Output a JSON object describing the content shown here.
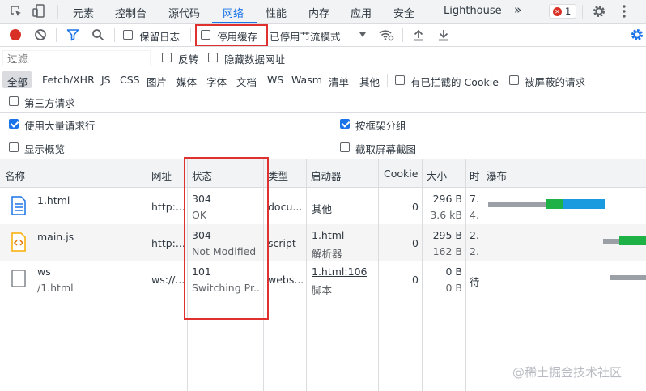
{
  "tabs": {
    "items": [
      "元素",
      "控制台",
      "源代码",
      "网络",
      "性能",
      "内存",
      "应用",
      "安全",
      "Lighthouse"
    ],
    "more": "»",
    "error_count": "1"
  },
  "toolbar": {
    "preserve_log": "保留日志",
    "disable_cache": "停用缓存",
    "throttle": "已停用节流模式"
  },
  "filter": {
    "placeholder": "过滤",
    "invert": "反转",
    "hide_data_urls": "隐藏数据网址"
  },
  "types": [
    "全部",
    "Fetch/XHR",
    "JS",
    "CSS",
    "图片",
    "媒体",
    "字体",
    "文档",
    "WS",
    "Wasm",
    "清单",
    "其他"
  ],
  "blocked_cookies": "有已拦截的 Cookie",
  "blocked_requests": "被屏蔽的请求",
  "third_party": "第三方请求",
  "settings": {
    "big_rows": "使用大量请求行",
    "group_by_frame": "按框架分组",
    "overview": "显示概览",
    "screenshots": "截取屏幕截图"
  },
  "table": {
    "headers": {
      "name": "名称",
      "url": "网址",
      "status": "状态",
      "type": "类型",
      "initiator": "启动器",
      "cookie": "Cookie",
      "size": "大小",
      "time": "时",
      "waterfall": "瀑布"
    },
    "rows": [
      {
        "name": "1.html",
        "path": "",
        "url": "http:...",
        "status_code": "304",
        "status_text": "OK",
        "type": "docu...",
        "initiator": "其他",
        "initiator_sub": "",
        "cookie": "0",
        "size_top": "296 B",
        "size_bottom": "3.6 kB",
        "time_top": "7.",
        "time_bottom": "4."
      },
      {
        "name": "main.js",
        "path": "",
        "url": "http:...",
        "status_code": "304",
        "status_text": "Not Modified",
        "type": "script",
        "initiator": "1.html",
        "initiator_sub": "解析器",
        "cookie": "0",
        "size_top": "295 B",
        "size_bottom": "162 B",
        "time_top": "2.",
        "time_bottom": "2."
      },
      {
        "name": "ws",
        "path": "/1.html",
        "url": "ws://...",
        "status_code": "101",
        "status_text": "Switching Pr...",
        "type": "webs...",
        "initiator": "1.html:106",
        "initiator_sub": "脚本",
        "cookie": "0",
        "size_top": "0 B",
        "size_bottom": "0 B",
        "time_top": "待",
        "time_bottom": ""
      }
    ]
  },
  "watermark": "@稀土掘金技术社区",
  "colors": {
    "accent": "#1a73e8",
    "highlight": "#e03131",
    "record": "#d93025",
    "wait_bar": "#9aa0a6",
    "green_bar": "#1db146",
    "blue_bar": "#1a9be0"
  }
}
